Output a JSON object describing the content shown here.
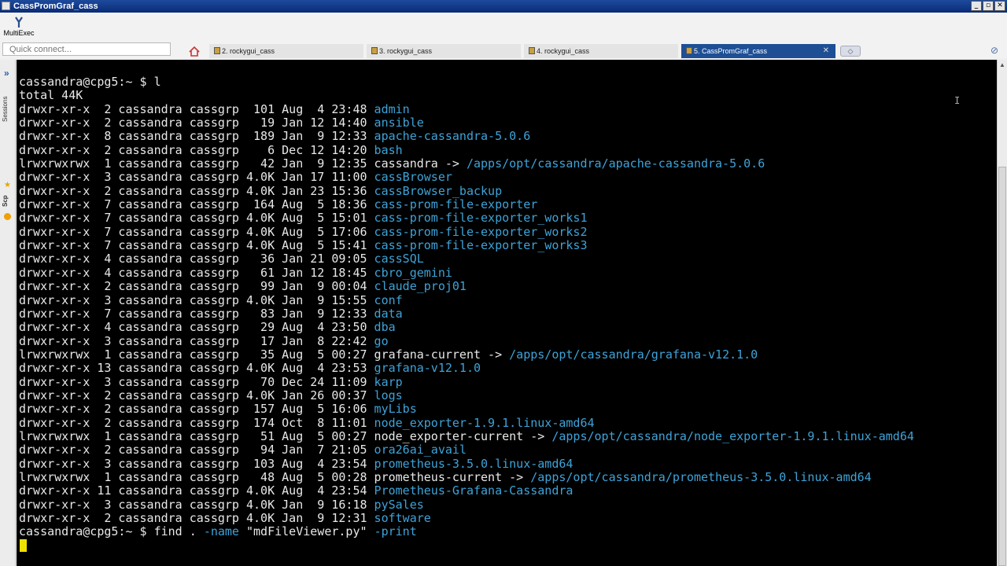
{
  "window": {
    "title": "CassPromGraf_cass",
    "minimize": "_",
    "restore": "▫",
    "close": "✕"
  },
  "toolbar": {
    "multiexec_label": "MultiExec",
    "quick_connect_placeholder": "Quick connect..."
  },
  "tabs": [
    {
      "label": "2. rockygui_cass"
    },
    {
      "label": "3. rockygui_cass"
    },
    {
      "label": "4. rockygui_cass"
    },
    {
      "label": "5. CassPromGraf_cass",
      "close": "✕"
    }
  ],
  "sidebar": {
    "sessions_label": "Sessions",
    "scp_label": "Scp"
  },
  "terminal": {
    "prompt1": "cassandra@cpg5:~ $ l",
    "total": "total 44K",
    "entries": [
      {
        "meta": "drwxr-xr-x  2 cassandra cassgrp  101 Aug  4 23:48 ",
        "name": "admin",
        "link": ""
      },
      {
        "meta": "drwxr-xr-x  2 cassandra cassgrp   19 Jan 12 14:40 ",
        "name": "ansible",
        "link": ""
      },
      {
        "meta": "drwxr-xr-x  8 cassandra cassgrp  189 Jan  9 12:33 ",
        "name": "apache-cassandra-5.0.6",
        "link": ""
      },
      {
        "meta": "drwxr-xr-x  2 cassandra cassgrp    6 Dec 12 14:20 ",
        "name": "bash",
        "link": ""
      },
      {
        "meta": "lrwxrwxrwx  1 cassandra cassgrp   42 Jan  9 12:35 ",
        "name": "cassandra",
        "link": "/apps/opt/cassandra/apache-cassandra-5.0.6"
      },
      {
        "meta": "drwxr-xr-x  3 cassandra cassgrp 4.0K Jan 17 11:00 ",
        "name": "cassBrowser",
        "link": ""
      },
      {
        "meta": "drwxr-xr-x  2 cassandra cassgrp 4.0K Jan 23 15:36 ",
        "name": "cassBrowser_backup",
        "link": ""
      },
      {
        "meta": "drwxr-xr-x  7 cassandra cassgrp  164 Aug  5 18:36 ",
        "name": "cass-prom-file-exporter",
        "link": ""
      },
      {
        "meta": "drwxr-xr-x  7 cassandra cassgrp 4.0K Aug  5 15:01 ",
        "name": "cass-prom-file-exporter_works1",
        "link": ""
      },
      {
        "meta": "drwxr-xr-x  7 cassandra cassgrp 4.0K Aug  5 17:06 ",
        "name": "cass-prom-file-exporter_works2",
        "link": ""
      },
      {
        "meta": "drwxr-xr-x  7 cassandra cassgrp 4.0K Aug  5 15:41 ",
        "name": "cass-prom-file-exporter_works3",
        "link": ""
      },
      {
        "meta": "drwxr-xr-x  4 cassandra cassgrp   36 Jan 21 09:05 ",
        "name": "cassSQL",
        "link": ""
      },
      {
        "meta": "drwxr-xr-x  4 cassandra cassgrp   61 Jan 12 18:45 ",
        "name": "cbro_gemini",
        "link": ""
      },
      {
        "meta": "drwxr-xr-x  2 cassandra cassgrp   99 Jan  9 00:04 ",
        "name": "claude_proj01",
        "link": ""
      },
      {
        "meta": "drwxr-xr-x  3 cassandra cassgrp 4.0K Jan  9 15:55 ",
        "name": "conf",
        "link": ""
      },
      {
        "meta": "drwxr-xr-x  7 cassandra cassgrp   83 Jan  9 12:33 ",
        "name": "data",
        "link": ""
      },
      {
        "meta": "drwxr-xr-x  4 cassandra cassgrp   29 Aug  4 23:50 ",
        "name": "dba",
        "link": ""
      },
      {
        "meta": "drwxr-xr-x  3 cassandra cassgrp   17 Jan  8 22:42 ",
        "name": "go",
        "link": ""
      },
      {
        "meta": "lrwxrwxrwx  1 cassandra cassgrp   35 Aug  5 00:27 ",
        "name": "grafana-current",
        "link": "/apps/opt/cassandra/grafana-v12.1.0"
      },
      {
        "meta": "drwxr-xr-x 13 cassandra cassgrp 4.0K Aug  4 23:53 ",
        "name": "grafana-v12.1.0",
        "link": ""
      },
      {
        "meta": "drwxr-xr-x  3 cassandra cassgrp   70 Dec 24 11:09 ",
        "name": "karp",
        "link": ""
      },
      {
        "meta": "drwxr-xr-x  2 cassandra cassgrp 4.0K Jan 26 00:37 ",
        "name": "logs",
        "link": ""
      },
      {
        "meta": "drwxr-xr-x  2 cassandra cassgrp  157 Aug  5 16:06 ",
        "name": "myLibs",
        "link": ""
      },
      {
        "meta": "drwxr-xr-x  2 cassandra cassgrp  174 Oct  8 11:01 ",
        "name": "node_exporter-1.9.1.linux-amd64",
        "link": ""
      },
      {
        "meta": "lrwxrwxrwx  1 cassandra cassgrp   51 Aug  5 00:27 ",
        "name": "node_exporter-current",
        "link": "/apps/opt/cassandra/node_exporter-1.9.1.linux-amd64"
      },
      {
        "meta": "drwxr-xr-x  2 cassandra cassgrp   94 Jan  7 21:05 ",
        "name": "ora26ai_avail",
        "link": ""
      },
      {
        "meta": "drwxr-xr-x  3 cassandra cassgrp  103 Aug  4 23:54 ",
        "name": "prometheus-3.5.0.linux-amd64",
        "link": ""
      },
      {
        "meta": "lrwxrwxrwx  1 cassandra cassgrp   48 Aug  5 00:28 ",
        "name": "prometheus-current",
        "link": "/apps/opt/cassandra/prometheus-3.5.0.linux-amd64"
      },
      {
        "meta": "drwxr-xr-x 11 cassandra cassgrp 4.0K Aug  4 23:54 ",
        "name": "Prometheus-Grafana-Cassandra",
        "link": ""
      },
      {
        "meta": "drwxr-xr-x  3 cassandra cassgrp 4.0K Jan  9 16:18 ",
        "name": "pySales",
        "link": ""
      },
      {
        "meta": "drwxr-xr-x  2 cassandra cassgrp 4.0K Jan  9 12:31 ",
        "name": "software",
        "link": ""
      }
    ],
    "prompt2_cmd": "cassandra@cpg5:~ $ find . ",
    "prompt2_opt": "-name",
    "prompt2_arg": " \"mdFileViewer.py\" ",
    "prompt2_opt2": "-print"
  },
  "colors": {
    "directory": "#3ea3d8",
    "terminal_bg": "#000000",
    "terminal_fg": "#e8e8e8",
    "active_tab": "#1e4f95",
    "cursor": "#f0e000"
  }
}
